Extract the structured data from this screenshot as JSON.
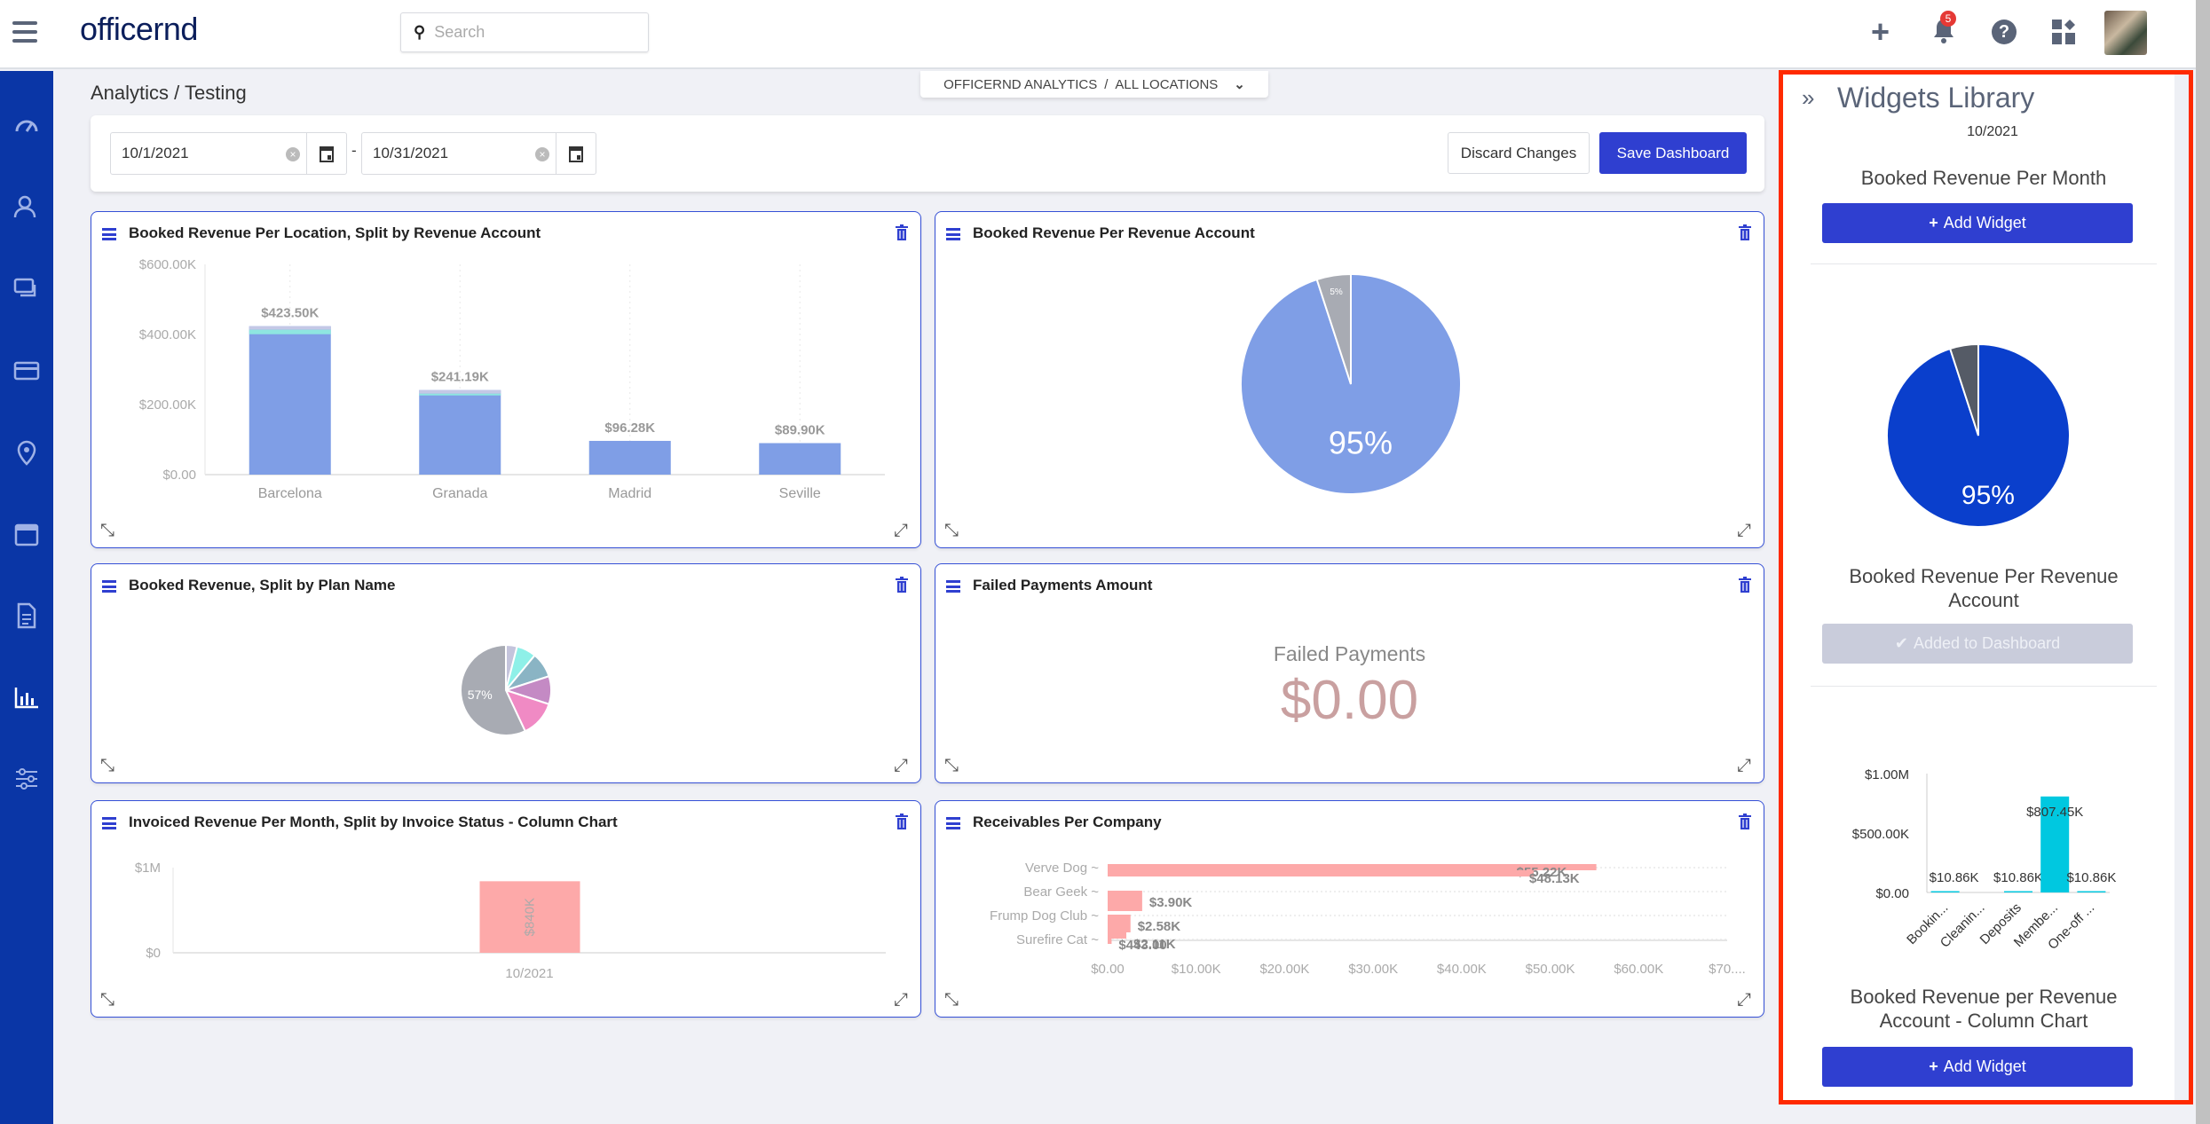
{
  "header": {
    "logo": "officernd",
    "search_placeholder": "Search",
    "notification_count": "5"
  },
  "breadcrumb": "Analytics / Testing",
  "context_switcher": {
    "analytics": "OFFICERND ANALYTICS",
    "separator": "/",
    "location": "ALL LOCATIONS"
  },
  "filters": {
    "start_date": "10/1/2021",
    "end_date": "10/31/2021",
    "separator": "-",
    "discard_label": "Discard Changes",
    "save_label": "Save Dashboard"
  },
  "colors": {
    "brand": "#0a36a6",
    "accent": "#2f3fd0",
    "bar": "#7f9ee6",
    "pink": "#fda9a9",
    "cyan": "#00c8e0",
    "highlight": "#ff2a00"
  },
  "widgets": {
    "w1": {
      "title": "Booked Revenue Per Location, Split by Revenue Account"
    },
    "w2": {
      "title": "Booked Revenue Per Revenue Account"
    },
    "w3": {
      "title": "Booked Revenue, Split by Plan Name"
    },
    "w4": {
      "title": "Failed Payments Amount",
      "label": "Failed Payments",
      "value": "$0.00"
    },
    "w5": {
      "title": "Invoiced Revenue Per Month, Split by Invoice Status - Column Chart"
    },
    "w6": {
      "title": "Receivables Per Company"
    }
  },
  "chart_data": [
    {
      "type": "bar",
      "title": "Booked Revenue Per Location, Split by Revenue Account",
      "categories": [
        "Barcelona",
        "Granada",
        "Madrid",
        "Seville"
      ],
      "values": [
        423.5,
        241.19,
        96.28,
        89.9
      ],
      "data_labels": [
        "$423.50K",
        "$241.19K",
        "$96.28K",
        "$89.90K"
      ],
      "unit": "K$",
      "ylim": [
        0,
        600
      ],
      "yticks": [
        "$0.00",
        "$200.00K",
        "$400.00K",
        "$600.00K"
      ]
    },
    {
      "type": "pie",
      "title": "Booked Revenue Per Revenue Account",
      "values": [
        95,
        5
      ],
      "labels": [
        "95%",
        "5%"
      ],
      "colors": [
        "#7f9ee6",
        "#a8abb3"
      ]
    },
    {
      "type": "pie",
      "title": "Booked Revenue, Split by Plan Name",
      "values": [
        4,
        7,
        9,
        10,
        13,
        57
      ],
      "labels": [
        "",
        "",
        "",
        "",
        "",
        "57%"
      ],
      "colors": [
        "#c4c4dc",
        "#8ef0e8",
        "#8ab4c4",
        "#c48ac4",
        "#f08ac4",
        "#a8abb3"
      ]
    },
    {
      "type": "bar",
      "title": "Invoiced Revenue Per Month, Split by Invoice Status - Column Chart",
      "categories": [
        "10/2021"
      ],
      "values": [
        840
      ],
      "unit": "K$",
      "data_labels": [
        "$840K"
      ],
      "ylim": [
        0,
        1000
      ],
      "yticks": [
        "$0",
        "$1M"
      ]
    },
    {
      "type": "bar",
      "orientation": "horizontal",
      "title": "Receivables Per Company",
      "category_labels": [
        "Verve Dog ~",
        "Bear Geek ~",
        "Frump Dog Club ~",
        "Surefire Cat ~"
      ],
      "values": [
        55.22,
        48.13,
        3.9,
        2.58,
        2.11,
        0.443
      ],
      "data_labels": [
        "$55.22K",
        "$48.13K",
        "$3.90K",
        "$2.58K",
        "$2.11K",
        "$443.00"
      ],
      "unit": "K$",
      "xlim": [
        0,
        70
      ],
      "xticks": [
        "$0.00",
        "$10.00K",
        "$20.00K",
        "$30.00K",
        "$40.00K",
        "$50.00K",
        "$60.00K",
        "$70...."
      ]
    },
    {
      "type": "pie",
      "title": "Booked Revenue Per Revenue Account",
      "values": [
        95,
        5
      ],
      "labels": [
        "95%",
        ""
      ],
      "colors": [
        "#0a3fcc",
        "#555b66"
      ]
    },
    {
      "type": "bar",
      "title": "Booked Revenue per Revenue Account - Column Chart",
      "categories": [
        "Bookin...",
        "Cleanin...",
        "Deposits",
        "Membe...",
        "One-off ..."
      ],
      "values": [
        10.86,
        null,
        10.86,
        807.45,
        10.86
      ],
      "data_labels": [
        "$10.86K",
        "",
        "$10.86K",
        "$807.45K",
        "$10.86K"
      ],
      "unit": "K$",
      "ylim": [
        0,
        1000
      ],
      "yticks": [
        "$0.00",
        "$500.00K",
        "$1.00M"
      ]
    }
  ],
  "library": {
    "title": "Widgets Library",
    "period": "10/2021",
    "items": [
      {
        "title": "Booked Revenue Per Month",
        "button": "Add Widget"
      },
      {
        "title": "Booked Revenue Per Revenue Account",
        "button": "Added to Dashboard"
      },
      {
        "title": "Booked Revenue per Revenue Account - Column Chart",
        "button": "Add Widget"
      }
    ]
  }
}
